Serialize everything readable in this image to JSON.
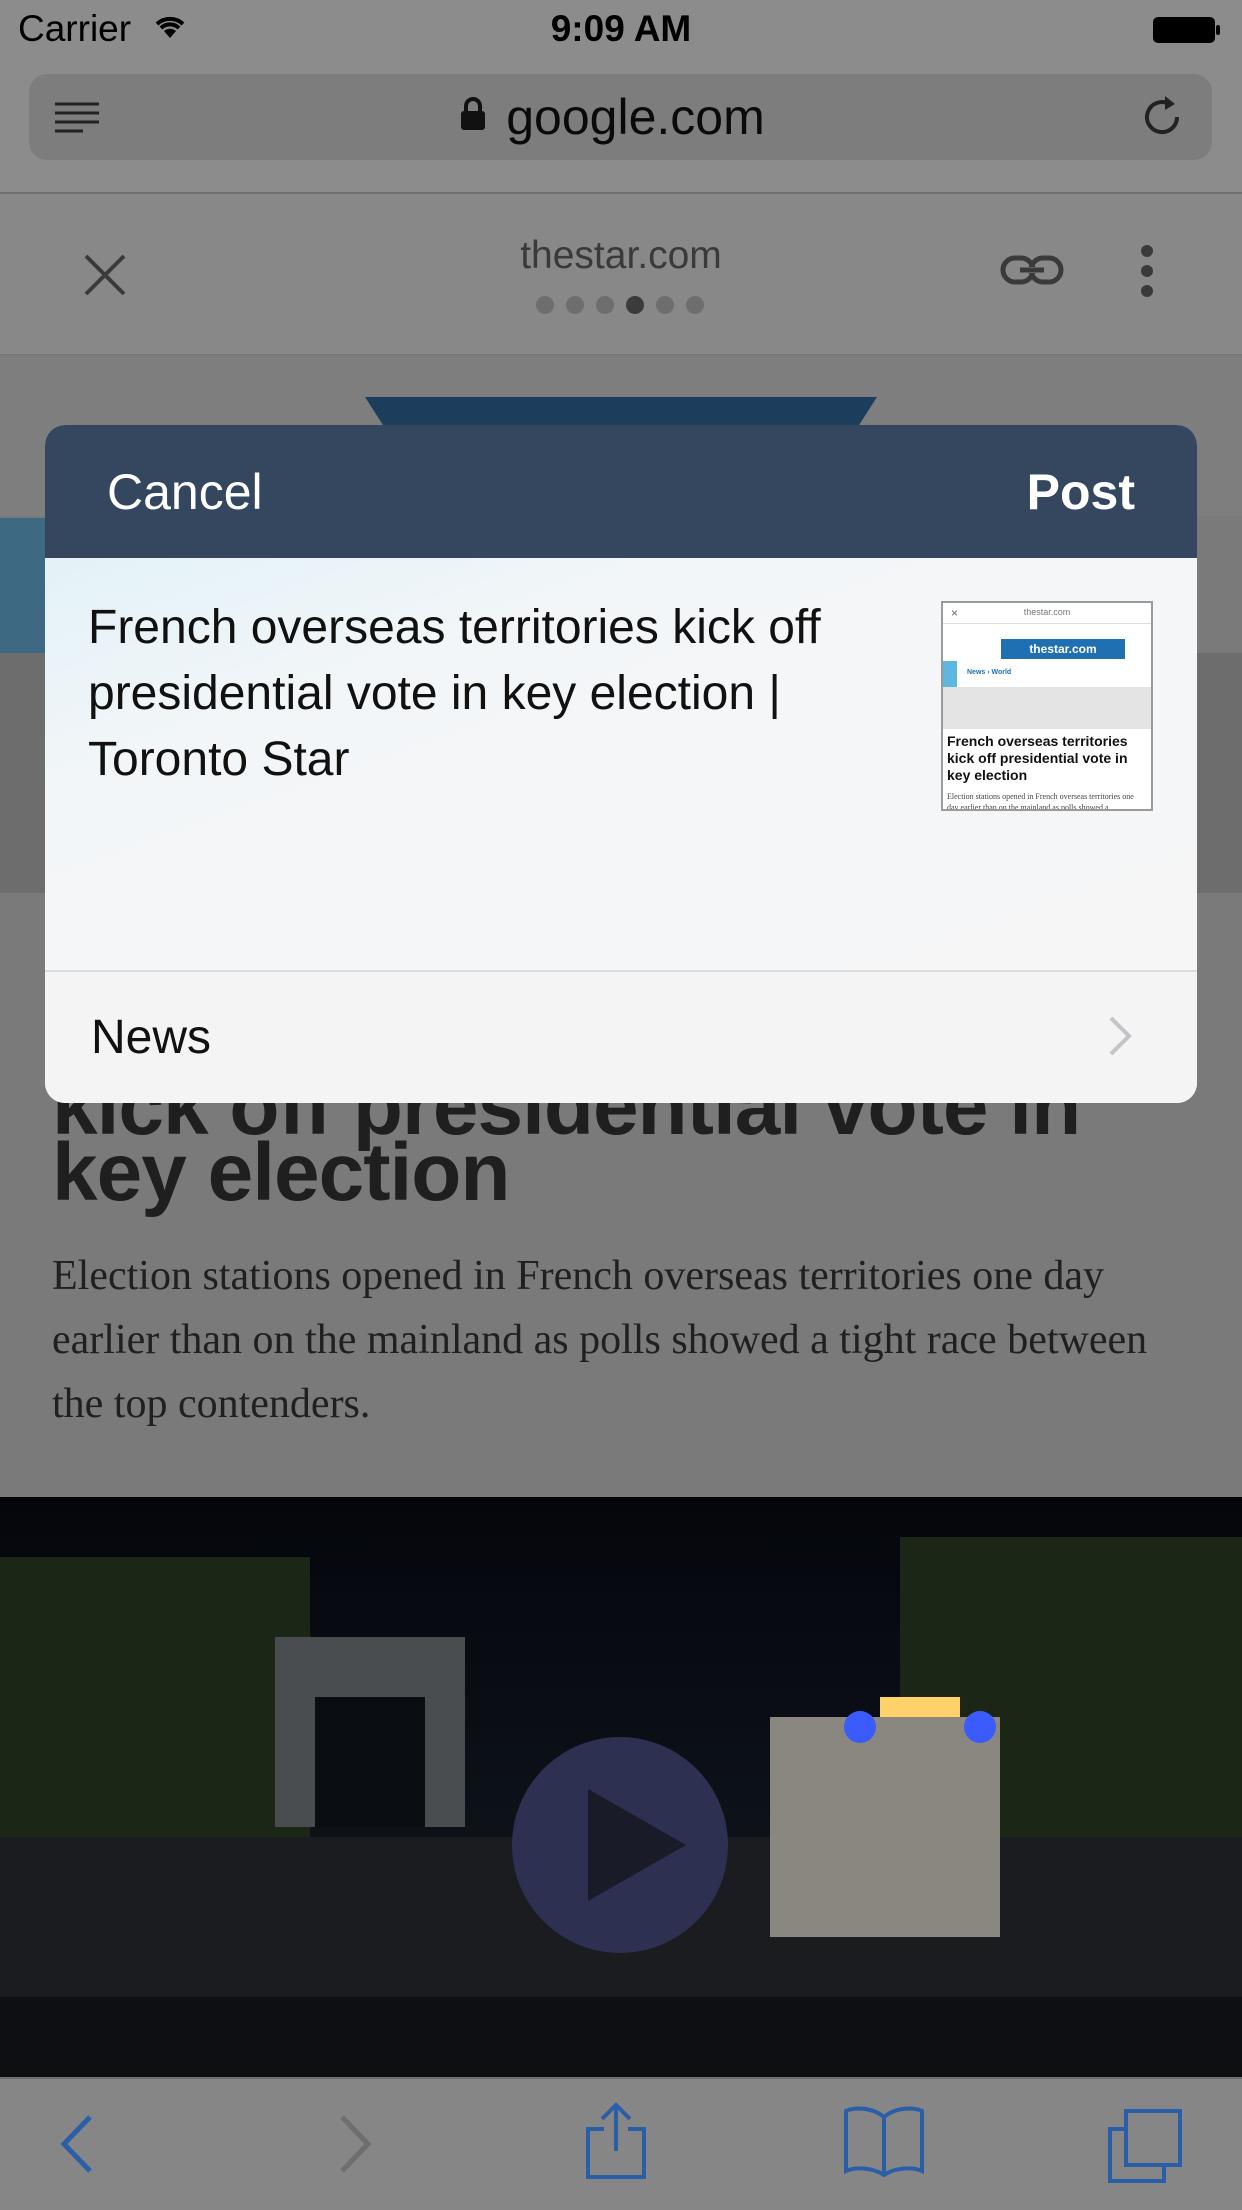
{
  "status_bar": {
    "carrier": "Carrier",
    "time": "9:09 AM"
  },
  "browser": {
    "url": "google.com"
  },
  "amp_header": {
    "domain": "thestar.com",
    "page_dots": 6,
    "active_dot": 4
  },
  "article": {
    "headline_cut": "kick off presidential vote in",
    "headline": "key election",
    "summary": "Election stations opened in French overseas territories one day earlier than on the mainland as polls showed a tight race between the top contenders."
  },
  "share_sheet": {
    "cancel_label": "Cancel",
    "post_label": "Post",
    "title": "French overseas territories kick off presidential vote in key election | Toronto Star",
    "category_label": "News",
    "thumbnail": {
      "domain": "thestar.com",
      "logo": "thestar.com",
      "nav": "News › World",
      "title": "French overseas territories kick off presidential vote in key election",
      "body": "Election stations opened in French overseas territories one day earlier than on the mainland as polls showed a"
    }
  },
  "colors": {
    "sheet_header": "#34475f",
    "link_blue": "#2a5fa8"
  }
}
